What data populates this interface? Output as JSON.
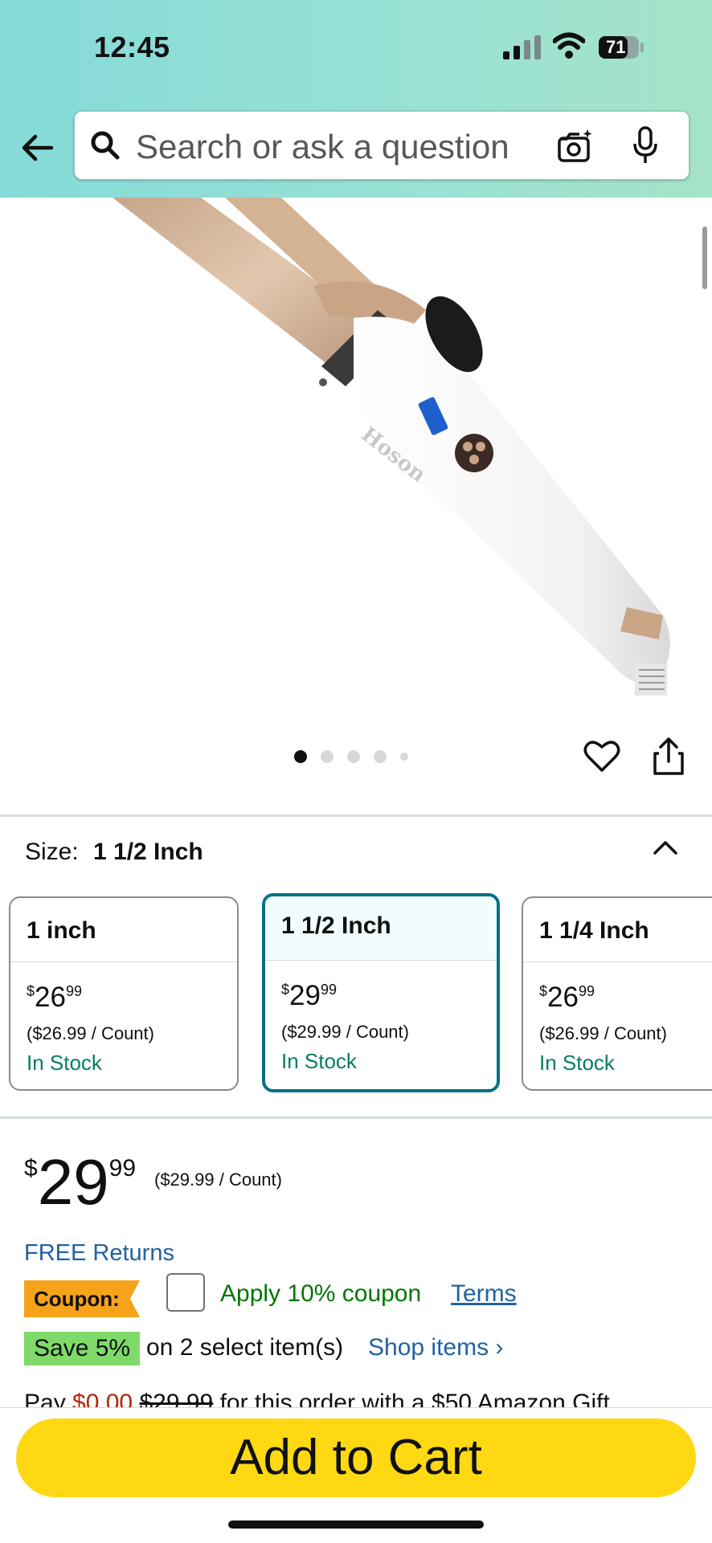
{
  "status_bar": {
    "time": "12:45",
    "battery": "71"
  },
  "search": {
    "placeholder": "Search or ask a question"
  },
  "image": {
    "brand_text": "Hoson",
    "current_slide": 1,
    "total_slides": 5
  },
  "size": {
    "label": "Size:",
    "selected": "1 1/2 Inch",
    "options": [
      {
        "name": "1 inch",
        "price_dollars": "26",
        "price_cents": "99",
        "unit_price": "($26.99 / Count)",
        "stock": "In Stock"
      },
      {
        "name": "1 1/2 Inch",
        "price_dollars": "29",
        "price_cents": "99",
        "unit_price": "($29.99 / Count)",
        "stock": "In Stock"
      },
      {
        "name": "1 1/4 Inch",
        "price_dollars": "26",
        "price_cents": "99",
        "unit_price": "($26.99 / Count)",
        "stock": "In Stock"
      }
    ]
  },
  "price": {
    "currency": "$",
    "dollars": "29",
    "cents": "99",
    "unit_price": "($29.99 / Count)",
    "free_returns": "FREE Returns"
  },
  "coupon": {
    "tag": "Coupon:",
    "apply_text": "Apply 10% coupon",
    "terms": "Terms"
  },
  "savings": {
    "badge": "Save 5%",
    "text": "on 2 select item(s)",
    "shop_link": "Shop items ›"
  },
  "pay_line": {
    "prefix": "Pay",
    "amount": "$0.00",
    "original": "$29.99",
    "rest": "for this order with a $50 Amazon Gift"
  },
  "actions": {
    "add_to_cart": "Add to Cart"
  },
  "colors": {
    "accent": "#007185",
    "cart_button": "#ffd814",
    "in_stock": "#067d62",
    "link": "#2162a1",
    "coupon_tag": "#f7a21b",
    "save_badge": "#7fda69"
  }
}
